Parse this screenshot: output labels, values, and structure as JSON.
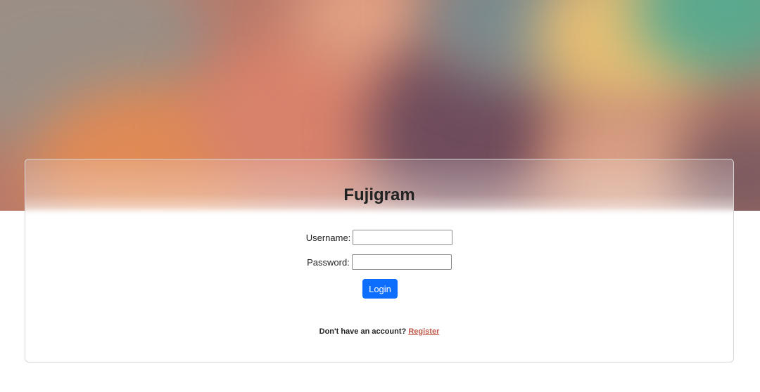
{
  "app": {
    "title": "Fujigram"
  },
  "form": {
    "username_label": "Username:",
    "username_value": "",
    "password_label": "Password:",
    "password_value": "",
    "login_label": "Login"
  },
  "footer": {
    "prompt": "Don't have an account?",
    "register_label": "Register"
  },
  "colors": {
    "accent": "#0d6efd",
    "link": "#c0574b"
  }
}
